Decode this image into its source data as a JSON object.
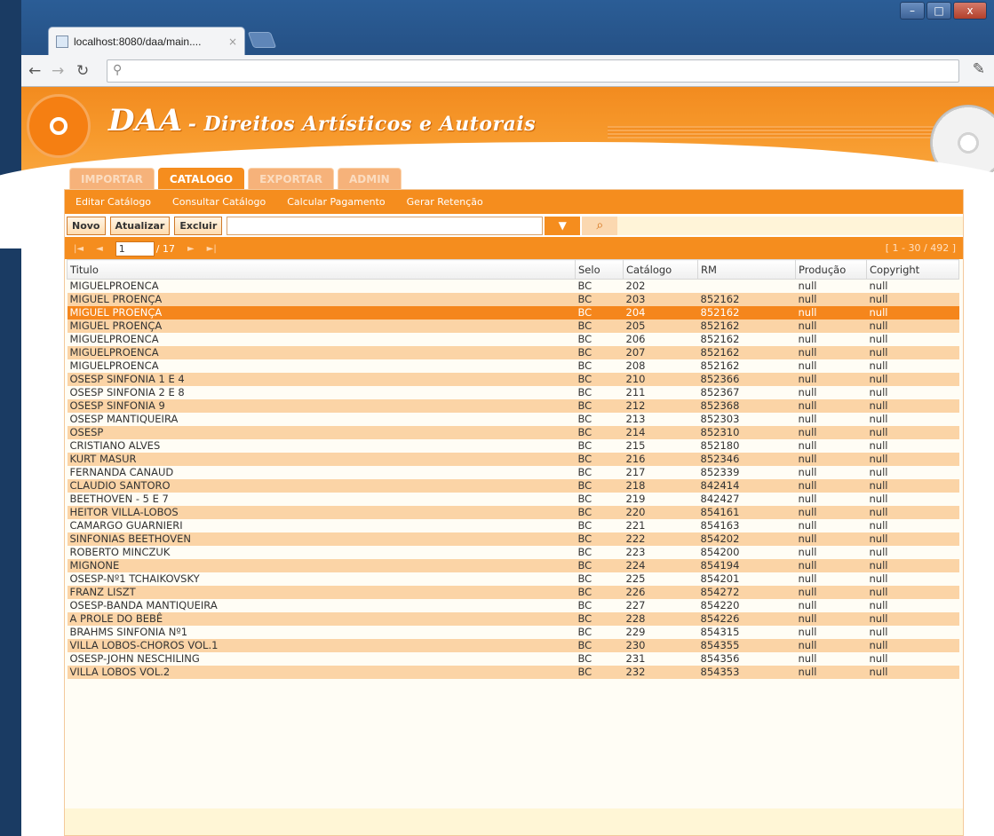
{
  "browser": {
    "tab_title": "localhost:8080/daa/main....",
    "tab_close": "×",
    "new_tab": "",
    "omnibox_value": "",
    "window_controls": [
      "–",
      "□",
      "x"
    ]
  },
  "banner": {
    "title": "DAA",
    "subtitle": "- Direitos Artísticos e Autorais"
  },
  "main_tabs": [
    {
      "label": "IMPORTAR",
      "active": false
    },
    {
      "label": "CATALOGO",
      "active": true
    },
    {
      "label": "EXPORTAR",
      "active": false
    },
    {
      "label": "ADMIN",
      "active": false
    }
  ],
  "submenu": [
    "Editar Catálogo",
    "Consultar Catálogo",
    "Calcular Pagamento",
    "Gerar Retenção"
  ],
  "actions": {
    "new": "Novo",
    "update": "Atualizar",
    "delete": "Excluir",
    "search_value": ""
  },
  "pager": {
    "first": "|◄",
    "prev": "◄",
    "current_page": "1",
    "total": "/ 17",
    "next": "►",
    "last": "►|",
    "record_info": "[ 1 - 30 / 492 ]"
  },
  "table": {
    "columns": [
      "Titulo",
      "Selo",
      "Catálogo",
      "RM",
      "Produção",
      "Copyright"
    ],
    "rows": [
      [
        "MIGUELPROENCA",
        "BC",
        "202",
        "",
        "null",
        "null"
      ],
      [
        "MIGUEL PROENÇA",
        "BC",
        "203",
        "852162",
        "null",
        "null"
      ],
      [
        "MIGUEL PROENÇA",
        "BC",
        "204",
        "852162",
        "null",
        "null"
      ],
      [
        "MIGUEL PROENÇA",
        "BC",
        "205",
        "852162",
        "null",
        "null"
      ],
      [
        "MIGUELPROENCA",
        "BC",
        "206",
        "852162",
        "null",
        "null"
      ],
      [
        "MIGUELPROENCA",
        "BC",
        "207",
        "852162",
        "null",
        "null"
      ],
      [
        "MIGUELPROENCA",
        "BC",
        "208",
        "852162",
        "null",
        "null"
      ],
      [
        "OSESP SINFONIA 1 E 4",
        "BC",
        "210",
        "852366",
        "null",
        "null"
      ],
      [
        "OSESP SINFONIA 2 E 8",
        "BC",
        "211",
        "852367",
        "null",
        "null"
      ],
      [
        "OSESP SINFONIA 9",
        "BC",
        "212",
        "852368",
        "null",
        "null"
      ],
      [
        "OSESP MANTIQUEIRA",
        "BC",
        "213",
        "852303",
        "null",
        "null"
      ],
      [
        "OSESP",
        "BC",
        "214",
        "852310",
        "null",
        "null"
      ],
      [
        "CRISTIANO ALVES",
        "BC",
        "215",
        "852180",
        "null",
        "null"
      ],
      [
        "KURT MASUR",
        "BC",
        "216",
        "852346",
        "null",
        "null"
      ],
      [
        "FERNANDA CANAUD",
        "BC",
        "217",
        "852339",
        "null",
        "null"
      ],
      [
        "CLAUDIO SANTORO",
        "BC",
        "218",
        "842414",
        "null",
        "null"
      ],
      [
        "BEETHOVEN - 5 E 7",
        "BC",
        "219",
        "842427",
        "null",
        "null"
      ],
      [
        "HEITOR VILLA-LOBOS",
        "BC",
        "220",
        "854161",
        "null",
        "null"
      ],
      [
        "CAMARGO GUARNIERI",
        "BC",
        "221",
        "854163",
        "null",
        "null"
      ],
      [
        "SINFONIAS BEETHOVEN",
        "BC",
        "222",
        "854202",
        "null",
        "null"
      ],
      [
        "ROBERTO MINCZUK",
        "BC",
        "223",
        "854200",
        "null",
        "null"
      ],
      [
        "MIGNONE",
        "BC",
        "224",
        "854194",
        "null",
        "null"
      ],
      [
        "OSESP-Nº1 TCHAIKOVSKY",
        "BC",
        "225",
        "854201",
        "null",
        "null"
      ],
      [
        "FRANZ LISZT",
        "BC",
        "226",
        "854272",
        "null",
        "null"
      ],
      [
        "OSESP-BANDA MANTIQUEIRA",
        "BC",
        "227",
        "854220",
        "null",
        "null"
      ],
      [
        "A PROLE DO BEBÊ",
        "BC",
        "228",
        "854226",
        "null",
        "null"
      ],
      [
        "BRAHMS SINFONIA Nº1",
        "BC",
        "229",
        "854315",
        "null",
        "null"
      ],
      [
        "VILLA LOBOS-CHOROS VOL.1",
        "BC",
        "230",
        "854355",
        "null",
        "null"
      ],
      [
        "OSESP-JOHN NESCHILING",
        "BC",
        "231",
        "854356",
        "null",
        "null"
      ],
      [
        "VILLA LOBOS VOL.2",
        "BC",
        "232",
        "854353",
        "null",
        "null"
      ]
    ],
    "selected_row": 2
  },
  "colors": {
    "accent": "#f58d1e",
    "row_alt": "#fbd4a6",
    "row_selected": "#f5861c"
  }
}
